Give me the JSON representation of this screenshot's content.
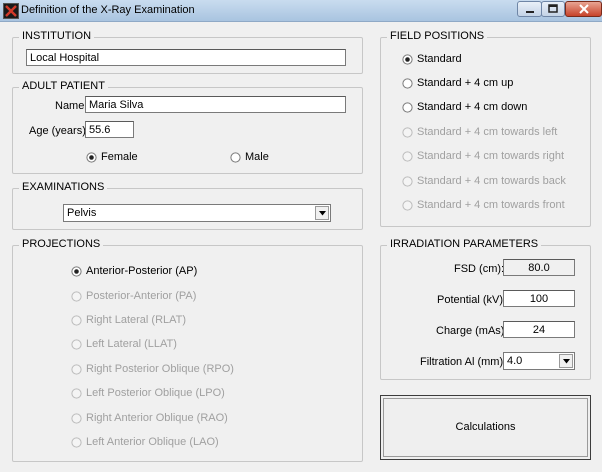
{
  "window": {
    "title": "Definition of the X-Ray Examination"
  },
  "institution": {
    "legend": "INSTITUTION",
    "value": "Local Hospital"
  },
  "patient": {
    "legend": "ADULT PATIENT",
    "name_label": "Name:",
    "name_value": "Maria Silva",
    "age_label": "Age (years):",
    "age_value": "55.6",
    "sex_options": [
      {
        "label": "Female",
        "selected": true
      },
      {
        "label": "Male",
        "selected": false
      }
    ]
  },
  "examinations": {
    "legend": "EXAMINATIONS",
    "selected": "Pelvis"
  },
  "projections": {
    "legend": "PROJECTIONS",
    "items": [
      {
        "label": "Anterior-Posterior (AP)",
        "selected": true,
        "enabled": true
      },
      {
        "label": "Posterior-Anterior (PA)",
        "selected": false,
        "enabled": false
      },
      {
        "label": "Right Lateral (RLAT)",
        "selected": false,
        "enabled": false
      },
      {
        "label": "Left Lateral (LLAT)",
        "selected": false,
        "enabled": false
      },
      {
        "label": "Right Posterior Oblique (RPO)",
        "selected": false,
        "enabled": false
      },
      {
        "label": "Left Posterior Oblique (LPO)",
        "selected": false,
        "enabled": false
      },
      {
        "label": "Right Anterior Oblique (RAO)",
        "selected": false,
        "enabled": false
      },
      {
        "label": "Left Anterior Oblique (LAO)",
        "selected": false,
        "enabled": false
      }
    ]
  },
  "field_positions": {
    "legend": "FIELD POSITIONS",
    "items": [
      {
        "label": "Standard",
        "selected": true,
        "enabled": true
      },
      {
        "label": "Standard + 4 cm up",
        "selected": false,
        "enabled": true
      },
      {
        "label": "Standard + 4 cm down",
        "selected": false,
        "enabled": true
      },
      {
        "label": "Standard + 4 cm towards left",
        "selected": false,
        "enabled": false
      },
      {
        "label": "Standard + 4 cm towards right",
        "selected": false,
        "enabled": false
      },
      {
        "label": "Standard + 4 cm towards back",
        "selected": false,
        "enabled": false
      },
      {
        "label": "Standard + 4 cm towards front",
        "selected": false,
        "enabled": false
      }
    ]
  },
  "irradiation": {
    "legend": "IRRADIATION PARAMETERS",
    "fsd_label": "FSD (cm):",
    "fsd_value": "80.0",
    "potential_label": "Potential (kV):",
    "potential_value": "100",
    "charge_label": "Charge (mAs):",
    "charge_value": "24",
    "filtration_label": "Filtration Al (mm):",
    "filtration_value": "4.0"
  },
  "actions": {
    "calculations_label": "Calculations"
  }
}
